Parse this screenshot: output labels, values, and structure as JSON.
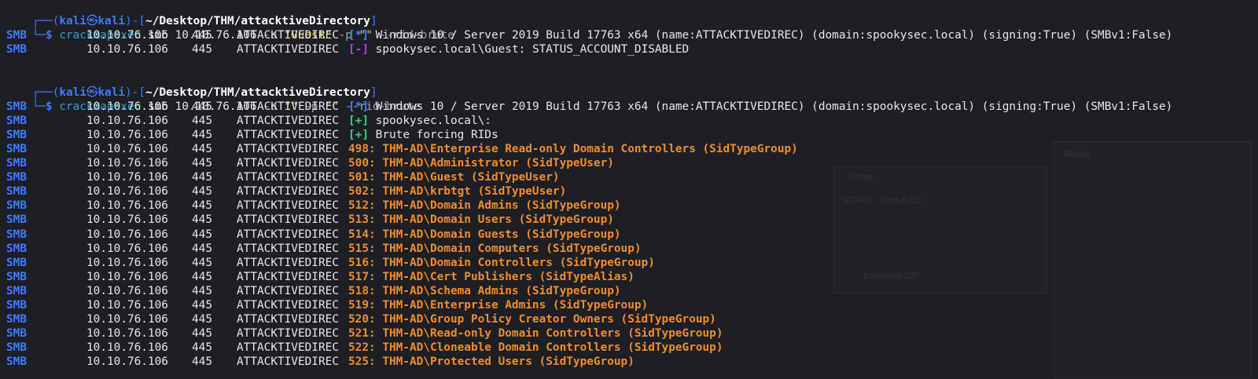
{
  "session1": {
    "prompt": {
      "user": "kali",
      "at": "㉿",
      "host": "kali",
      "dir": "~/Desktop/THM/attacktiveDirectory"
    },
    "command": {
      "name": "crackmapexec",
      "proto": "smb",
      "target": "10.10.76.106",
      "flag_u": "-u",
      "user": "\"Guest\"",
      "flag_p": "-p",
      "pass": "\"\"",
      "flag_rid": "--rid-brute"
    },
    "rows": [
      {
        "proto": "SMB",
        "ip": "10.10.76.106",
        "port": "445",
        "host": "ATTACKTIVEDIREC",
        "tag": "[*]",
        "tag_color": "blue",
        "msg": "Windows 10 / Server 2019 Build 17763 x64 (name:ATTACKTIVEDIREC) (domain:spookysec.local) (signing:True) (SMBv1:False)"
      },
      {
        "proto": "SMB",
        "ip": "10.10.76.106",
        "port": "445",
        "host": "ATTACKTIVEDIREC",
        "tag": "[-]",
        "tag_color": "purple",
        "msg": "spookysec.local\\Guest: STATUS_ACCOUNT_DISABLED"
      }
    ]
  },
  "session2": {
    "prompt": {
      "user": "kali",
      "at": "㉿",
      "host": "kali",
      "dir": "~/Desktop/THM/attacktiveDirectory"
    },
    "command": {
      "name": "crackmapexec",
      "proto": "smb",
      "target": "10.10.76.106",
      "flag_u": "-u",
      "user": "\"\"",
      "flag_p": "-p",
      "pass": "\"\"",
      "flag_rid": "--rid-brute"
    },
    "rows": [
      {
        "proto": "SMB",
        "ip": "10.10.76.106",
        "port": "445",
        "host": "ATTACKTIVEDIREC",
        "tag": "[*]",
        "tag_color": "blue",
        "msg": "Windows 10 / Server 2019 Build 17763 x64 (name:ATTACKTIVEDIREC) (domain:spookysec.local) (signing:True) (SMBv1:False)"
      },
      {
        "proto": "SMB",
        "ip": "10.10.76.106",
        "port": "445",
        "host": "ATTACKTIVEDIREC",
        "tag": "[+]",
        "tag_color": "green",
        "msg": "spookysec.local\\:"
      },
      {
        "proto": "SMB",
        "ip": "10.10.76.106",
        "port": "445",
        "host": "ATTACKTIVEDIREC",
        "tag": "[+]",
        "tag_color": "green",
        "msg": "Brute forcing RIDs"
      },
      {
        "proto": "SMB",
        "ip": "10.10.76.106",
        "port": "445",
        "host": "ATTACKTIVEDIREC",
        "rid": "498: THM-AD\\Enterprise Read-only Domain Controllers (SidTypeGroup)"
      },
      {
        "proto": "SMB",
        "ip": "10.10.76.106",
        "port": "445",
        "host": "ATTACKTIVEDIREC",
        "rid": "500: THM-AD\\Administrator (SidTypeUser)"
      },
      {
        "proto": "SMB",
        "ip": "10.10.76.106",
        "port": "445",
        "host": "ATTACKTIVEDIREC",
        "rid": "501: THM-AD\\Guest (SidTypeUser)"
      },
      {
        "proto": "SMB",
        "ip": "10.10.76.106",
        "port": "445",
        "host": "ATTACKTIVEDIREC",
        "rid": "502: THM-AD\\krbtgt (SidTypeUser)"
      },
      {
        "proto": "SMB",
        "ip": "10.10.76.106",
        "port": "445",
        "host": "ATTACKTIVEDIREC",
        "rid": "512: THM-AD\\Domain Admins (SidTypeGroup)"
      },
      {
        "proto": "SMB",
        "ip": "10.10.76.106",
        "port": "445",
        "host": "ATTACKTIVEDIREC",
        "rid": "513: THM-AD\\Domain Users (SidTypeGroup)"
      },
      {
        "proto": "SMB",
        "ip": "10.10.76.106",
        "port": "445",
        "host": "ATTACKTIVEDIREC",
        "rid": "514: THM-AD\\Domain Guests (SidTypeGroup)"
      },
      {
        "proto": "SMB",
        "ip": "10.10.76.106",
        "port": "445",
        "host": "ATTACKTIVEDIREC",
        "rid": "515: THM-AD\\Domain Computers (SidTypeGroup)"
      },
      {
        "proto": "SMB",
        "ip": "10.10.76.106",
        "port": "445",
        "host": "ATTACKTIVEDIREC",
        "rid": "516: THM-AD\\Domain Controllers (SidTypeGroup)"
      },
      {
        "proto": "SMB",
        "ip": "10.10.76.106",
        "port": "445",
        "host": "ATTACKTIVEDIREC",
        "rid": "517: THM-AD\\Cert Publishers (SidTypeAlias)"
      },
      {
        "proto": "SMB",
        "ip": "10.10.76.106",
        "port": "445",
        "host": "ATTACKTIVEDIREC",
        "rid": "518: THM-AD\\Schema Admins (SidTypeGroup)"
      },
      {
        "proto": "SMB",
        "ip": "10.10.76.106",
        "port": "445",
        "host": "ATTACKTIVEDIREC",
        "rid": "519: THM-AD\\Enterprise Admins (SidTypeGroup)"
      },
      {
        "proto": "SMB",
        "ip": "10.10.76.106",
        "port": "445",
        "host": "ATTACKTIVEDIREC",
        "rid": "520: THM-AD\\Group Policy Creator Owners (SidTypeGroup)"
      },
      {
        "proto": "SMB",
        "ip": "10.10.76.106",
        "port": "445",
        "host": "ATTACKTIVEDIREC",
        "rid": "521: THM-AD\\Read-only Domain Controllers (SidTypeGroup)"
      },
      {
        "proto": "SMB",
        "ip": "10.10.76.106",
        "port": "445",
        "host": "ATTACKTIVEDIREC",
        "rid": "522: THM-AD\\Cloneable Domain Controllers (SidTypeGroup)"
      },
      {
        "proto": "SMB",
        "ip": "10.10.76.106",
        "port": "445",
        "host": "ATTACKTIVEDIREC",
        "rid": "525: THM-AD\\Protected Users (SidTypeGroup)"
      }
    ]
  },
  "colors": {
    "blue": "#3d7bff",
    "purple": "#c13bd6",
    "green": "#33d17a",
    "orange": "#f08c2c",
    "background": "#1e1f24"
  },
  "ghost": {
    "about": "About",
    "clone": "Clone",
    "https": "HTTPS",
    "github_cli": "GitHub CLI",
    "download_zip": "Download ZIP"
  }
}
